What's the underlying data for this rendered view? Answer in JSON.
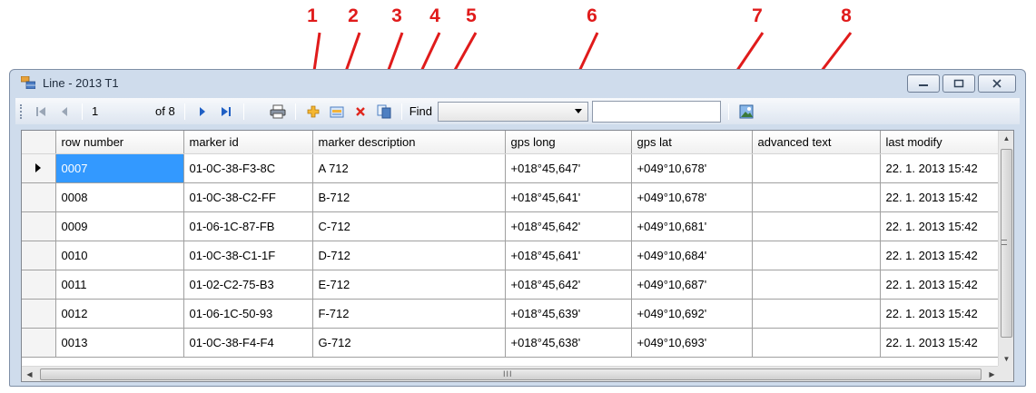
{
  "callouts": [
    "1",
    "2",
    "3",
    "4",
    "5",
    "6",
    "7",
    "8"
  ],
  "colors": {
    "callout": "#e01b1b",
    "selection": "#3399ff",
    "window_frame": "#cfdcec"
  },
  "window": {
    "title": "Line - 2013 T1",
    "icon": "datagrid-app-icon",
    "controls": [
      "minimize-icon",
      "maximize-icon",
      "close-icon"
    ]
  },
  "toolbar": {
    "navigator": {
      "position": "1",
      "of_label": "of 8",
      "icons": [
        "move-first-icon",
        "move-previous-icon",
        "move-next-icon",
        "move-last-icon"
      ]
    },
    "action_icons": [
      "print-icon",
      "add-icon",
      "edit-icon",
      "delete-icon",
      "copy-icon"
    ],
    "find_label": "Find",
    "find_field_value": "",
    "find_text_value": "",
    "image_icon": "image-icon"
  },
  "grid": {
    "columns": [
      "row number",
      "marker id",
      "marker description",
      "gps long",
      "gps lat",
      "advanced text",
      "last modify"
    ],
    "rows": [
      [
        "0007",
        "01-0C-38-F3-8C",
        "A 712",
        "+018°45,647'",
        "+049°10,678'",
        "",
        "22. 1. 2013 15:42"
      ],
      [
        "0008",
        "01-0C-38-C2-FF",
        "B-712",
        "+018°45,641'",
        "+049°10,678'",
        "",
        "22. 1. 2013 15:42"
      ],
      [
        "0009",
        "01-06-1C-87-FB",
        "C-712",
        "+018°45,642'",
        "+049°10,681'",
        "",
        "22. 1. 2013 15:42"
      ],
      [
        "0010",
        "01-0C-38-C1-1F",
        "D-712",
        "+018°45,641'",
        "+049°10,684'",
        "",
        "22. 1. 2013 15:42"
      ],
      [
        "0011",
        "01-02-C2-75-B3",
        "E-712",
        "+018°45,642'",
        "+049°10,687'",
        "",
        "22. 1. 2013 15:42"
      ],
      [
        "0012",
        "01-06-1C-50-93",
        "F-712",
        "+018°45,639'",
        "+049°10,692'",
        "",
        "22. 1. 2013 15:42"
      ],
      [
        "0013",
        "01-0C-38-F4-F4",
        "G-712",
        "+018°45,638'",
        "+049°10,693'",
        "",
        "22. 1. 2013 15:42"
      ]
    ],
    "selected_row": 0,
    "hscroll_grip": "III"
  }
}
